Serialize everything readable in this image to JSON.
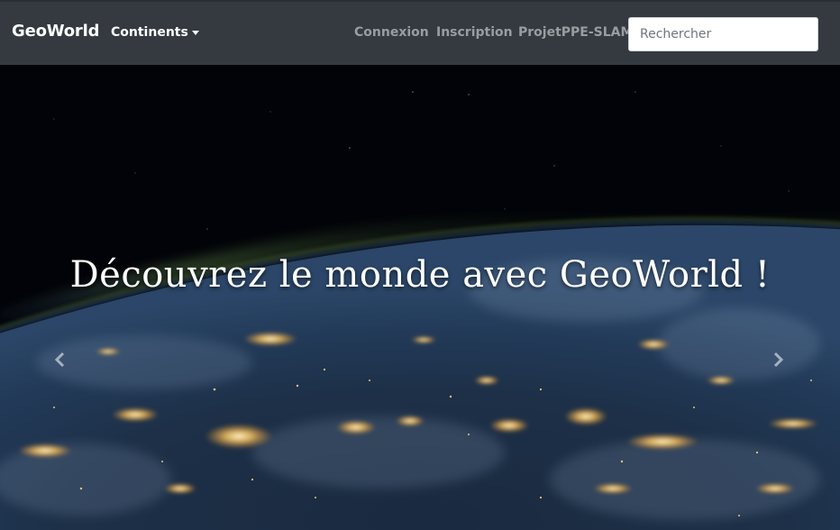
{
  "navbar": {
    "brand": "GeoWorld",
    "dropdown_label": "Continents",
    "links": [
      "Connexion",
      "Inscription",
      "ProjetPPE-SLAM"
    ],
    "search_placeholder": "Rechercher"
  },
  "carousel": {
    "caption": "Découvrez le monde avec GeoWorld !",
    "prev_icon": "chevron-left-icon",
    "next_icon": "chevron-right-icon"
  },
  "colors": {
    "navbar_bg": "#343a40",
    "nav_link": "#9a9da0",
    "city_lights": "#ffcc66"
  }
}
